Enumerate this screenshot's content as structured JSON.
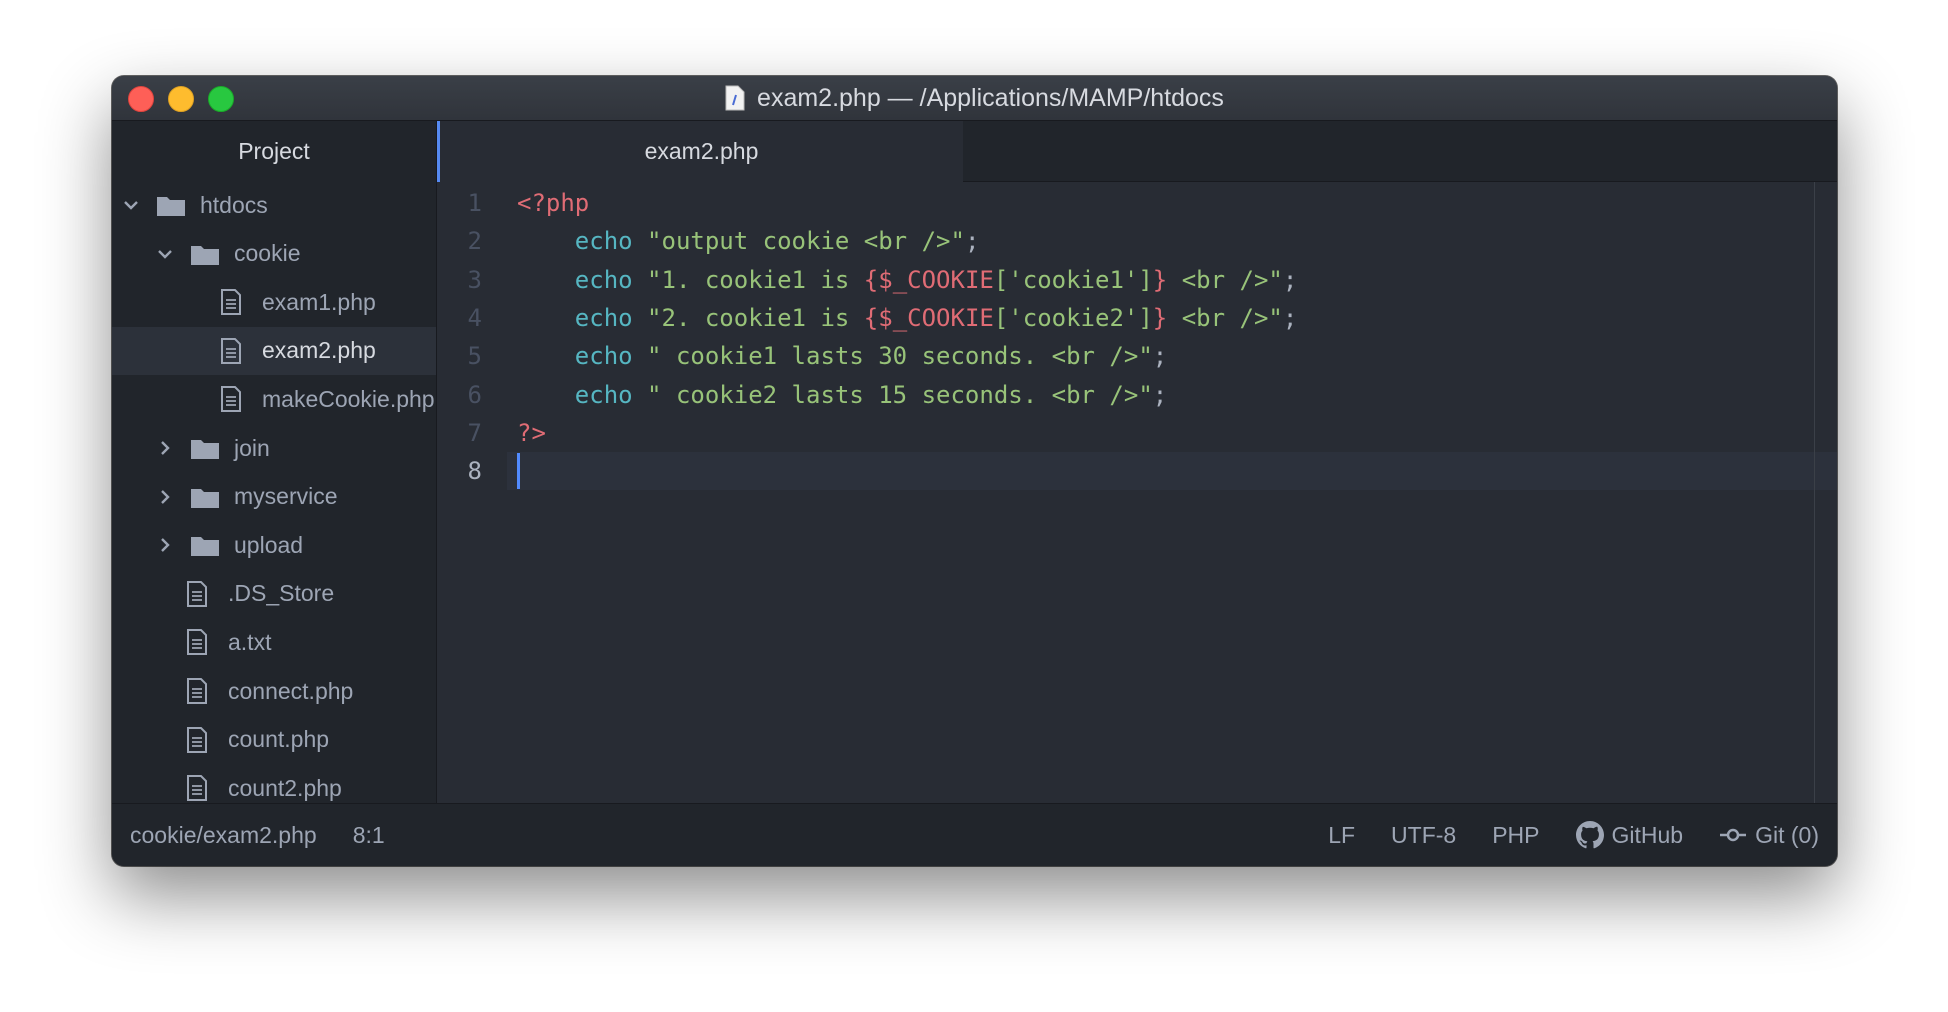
{
  "window": {
    "title": "exam2.php — /Applications/MAMP/htdocs"
  },
  "sidebar": {
    "header": "Project",
    "items": [
      {
        "label": "htdocs",
        "type": "folder",
        "expanded": true,
        "depth": 0
      },
      {
        "label": "cookie",
        "type": "folder",
        "expanded": true,
        "depth": 1
      },
      {
        "label": "exam1.php",
        "type": "file",
        "depth": 2
      },
      {
        "label": "exam2.php",
        "type": "file",
        "depth": 2,
        "selected": true
      },
      {
        "label": "makeCookie.php",
        "type": "file",
        "depth": 2
      },
      {
        "label": "join",
        "type": "folder",
        "expanded": false,
        "depth": 1
      },
      {
        "label": "myservice",
        "type": "folder",
        "expanded": false,
        "depth": 1
      },
      {
        "label": "upload",
        "type": "folder",
        "expanded": false,
        "depth": 1
      },
      {
        "label": ".DS_Store",
        "type": "file",
        "depth": 1
      },
      {
        "label": "a.txt",
        "type": "file",
        "depth": 1
      },
      {
        "label": "connect.php",
        "type": "file",
        "depth": 1
      },
      {
        "label": "count.php",
        "type": "file",
        "depth": 1
      },
      {
        "label": "count2.php",
        "type": "file",
        "depth": 1
      }
    ]
  },
  "tabs": [
    {
      "label": "exam2.php",
      "active": true
    }
  ],
  "editor": {
    "cursor_line": 8,
    "lines": [
      {
        "num": "1",
        "tokens": [
          {
            "t": "<?php",
            "c": "tag"
          }
        ]
      },
      {
        "num": "2",
        "tokens": [
          {
            "t": "    ",
            "c": ""
          },
          {
            "t": "echo",
            "c": "kw"
          },
          {
            "t": " ",
            "c": ""
          },
          {
            "t": "\"output cookie <br />\"",
            "c": "str"
          },
          {
            "t": ";",
            "c": ""
          }
        ]
      },
      {
        "num": "3",
        "tokens": [
          {
            "t": "    ",
            "c": ""
          },
          {
            "t": "echo",
            "c": "kw"
          },
          {
            "t": " ",
            "c": ""
          },
          {
            "t": "\"1. cookie1 is ",
            "c": "str"
          },
          {
            "t": "{$_COOKIE",
            "c": "var"
          },
          {
            "t": "['cookie1']",
            "c": "str"
          },
          {
            "t": "}",
            "c": "var"
          },
          {
            "t": " <br />\"",
            "c": "str"
          },
          {
            "t": ";",
            "c": ""
          }
        ]
      },
      {
        "num": "4",
        "tokens": [
          {
            "t": "    ",
            "c": ""
          },
          {
            "t": "echo",
            "c": "kw"
          },
          {
            "t": " ",
            "c": ""
          },
          {
            "t": "\"2. cookie1 is ",
            "c": "str"
          },
          {
            "t": "{$_COOKIE",
            "c": "var"
          },
          {
            "t": "['cookie2']",
            "c": "str"
          },
          {
            "t": "}",
            "c": "var"
          },
          {
            "t": " <br />\"",
            "c": "str"
          },
          {
            "t": ";",
            "c": ""
          }
        ]
      },
      {
        "num": "5",
        "tokens": [
          {
            "t": "    ",
            "c": ""
          },
          {
            "t": "echo",
            "c": "kw"
          },
          {
            "t": " ",
            "c": ""
          },
          {
            "t": "\" cookie1 lasts 30 seconds. <br />\"",
            "c": "str"
          },
          {
            "t": ";",
            "c": ""
          }
        ]
      },
      {
        "num": "6",
        "tokens": [
          {
            "t": "    ",
            "c": ""
          },
          {
            "t": "echo",
            "c": "kw"
          },
          {
            "t": " ",
            "c": ""
          },
          {
            "t": "\" cookie2 lasts 15 seconds. <br />\"",
            "c": "str"
          },
          {
            "t": ";",
            "c": ""
          }
        ]
      },
      {
        "num": "7",
        "tokens": [
          {
            "t": "?>",
            "c": "tag"
          }
        ]
      },
      {
        "num": "8",
        "tokens": []
      }
    ]
  },
  "status": {
    "file_path": "cookie/exam2.php",
    "cursor_pos": "8:1",
    "line_ending": "LF",
    "encoding": "UTF-8",
    "grammar": "PHP",
    "github_label": "GitHub",
    "git_label": "Git (0)"
  },
  "colors": {
    "accent": "#568af2",
    "tag": "#e06c75",
    "keyword": "#56b6c2",
    "string": "#98c379"
  }
}
